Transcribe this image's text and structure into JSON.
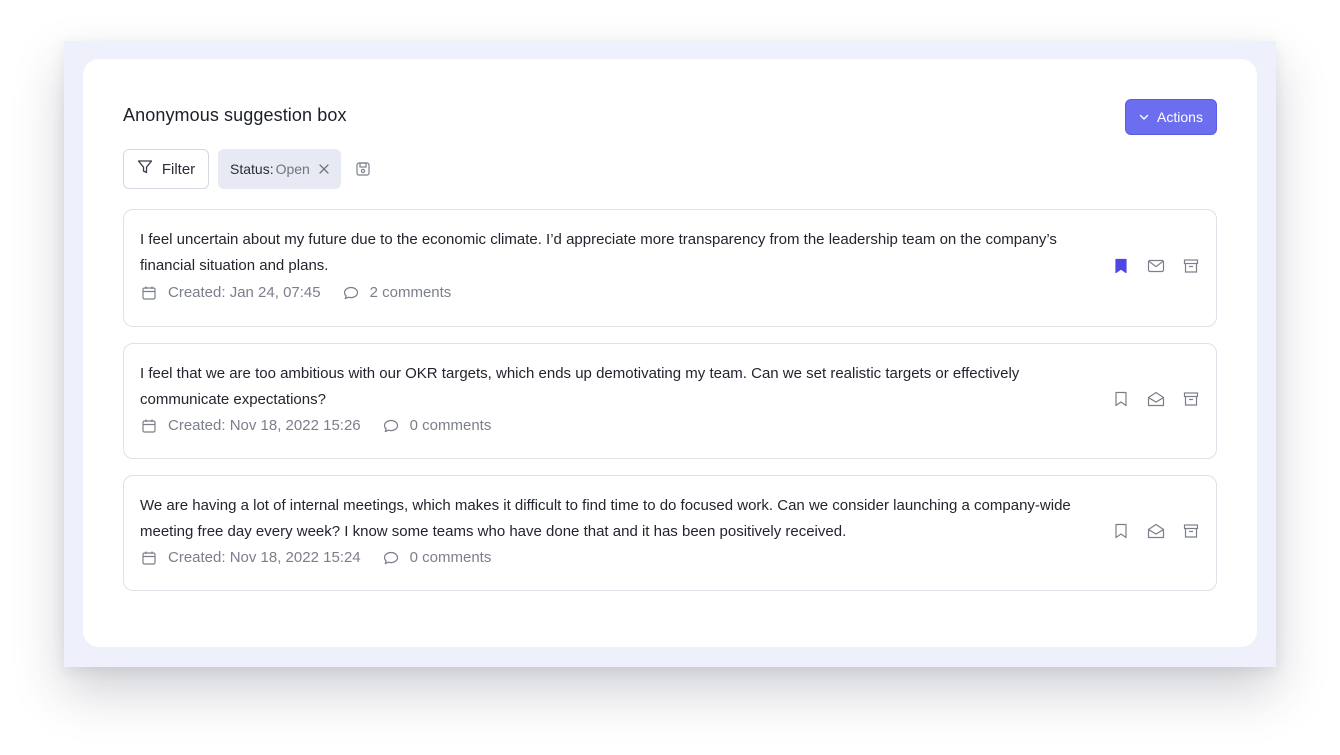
{
  "page": {
    "title": "Anonymous suggestion box",
    "actions_label": "Actions",
    "filter_label": "Filter",
    "active_filter": {
      "key": "Status:",
      "value": "Open"
    }
  },
  "colors": {
    "accent": "#6c6ef0",
    "bookmark_active": "#4f46e5",
    "muted_text": "#7b7f8c",
    "chip_bg": "#e8eaf3",
    "frame_bg": "#eef0fb"
  },
  "icons": {
    "actions": "chevron-down-icon",
    "filter": "filter-icon",
    "chip_remove": "close-icon",
    "save_filter": "save-icon",
    "date": "calendar-icon",
    "comments": "comment-icon",
    "bookmark": "bookmark-icon",
    "mail_unread": "mail-closed-icon",
    "mail_read": "mail-open-icon",
    "archive": "archive-icon"
  },
  "suggestions": [
    {
      "text": "I feel uncertain about my future due to the economic climate. I’d appreciate more transparency from the leadership team on the company’s financial situation and plans.",
      "created": "Created: Jan 24, 07:45",
      "comments": "2 comments",
      "bookmarked": true,
      "read": false
    },
    {
      "text": "I feel that we are too ambitious with our OKR targets, which ends up demotivating my team. Can we set realistic targets or effectively communicate expectations?",
      "created": "Created: Nov 18, 2022 15:26",
      "comments": "0 comments",
      "bookmarked": false,
      "read": true
    },
    {
      "text": "We are having a lot of internal meetings, which makes it difficult to find time to do focused work. Can we consider launching a company-wide meeting free day every week? I know some teams who have done that and it has been positively received.",
      "created": "Created: Nov 18, 2022 15:24",
      "comments": "0 comments",
      "bookmarked": false,
      "read": true
    }
  ]
}
